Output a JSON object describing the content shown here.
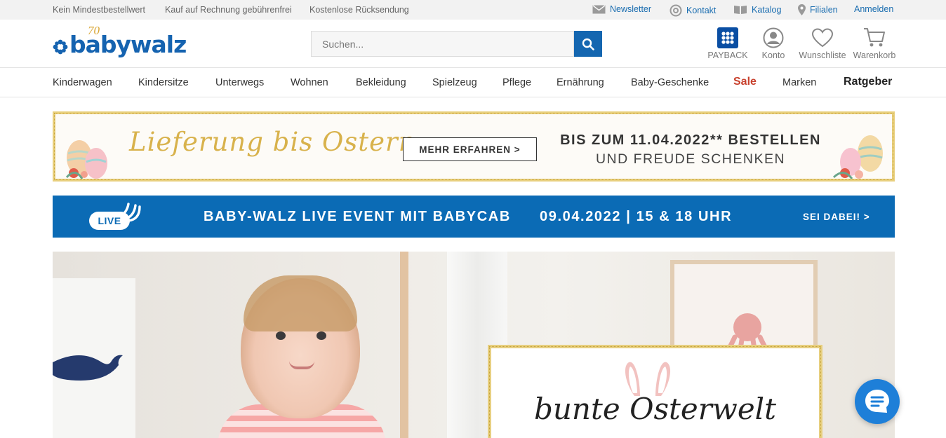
{
  "topbar": {
    "usps": [
      "Kein Mindestbestellwert",
      "Kauf auf Rechnung gebührenfrei",
      "Kostenlose Rücksendung"
    ],
    "links": {
      "newsletter": "Newsletter",
      "contact": "Kontakt",
      "catalog": "Katalog",
      "stores": "Filialen",
      "login": "Anmelden"
    }
  },
  "header": {
    "logo_text": "babywalz",
    "logo_anniversary": "70",
    "search_placeholder": "Suchen...",
    "icons": {
      "payback": "PAYBACK",
      "account": "Konto",
      "wishlist": "Wunschliste",
      "cart": "Warenkorb"
    }
  },
  "nav": {
    "items": [
      "Kinderwagen",
      "Kindersitze",
      "Unterwegs",
      "Wohnen",
      "Bekleidung",
      "Spielzeug",
      "Pflege",
      "Ernährung",
      "Baby-Geschenke"
    ],
    "sale": "Sale",
    "brands": "Marken",
    "guide": "Ratgeber"
  },
  "easter_banner": {
    "script": "Lieferung bis Ostern",
    "button": "MEHR ERFAHREN >",
    "line1": "BIS ZUM 11.04.2022** BESTELLEN",
    "line2": "UND FREUDE SCHENKEN"
  },
  "live_banner": {
    "badge": "LIVE",
    "title": "BABY-WALZ LIVE EVENT MIT BABYCAB",
    "date": "09.04.2022 | 15 & 18 UHR",
    "cta": "SEI DABEI! >"
  },
  "hero": {
    "card_script": "bunte Osterwelt"
  },
  "colors": {
    "brand_blue": "#1466b0",
    "live_blue": "#0b6bb5",
    "sale_red": "#c8412e",
    "gold": "#e8cf7d"
  }
}
